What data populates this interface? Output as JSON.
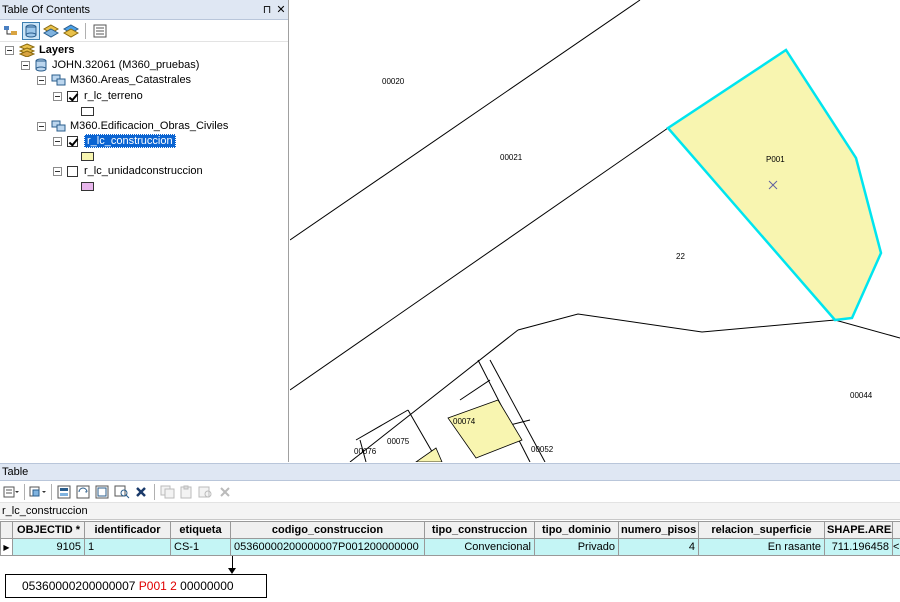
{
  "toc": {
    "title": "Table Of Contents",
    "pin_glyph": "⊓",
    "close_glyph": "✕",
    "layers_label": "Layers",
    "db_label": "JOHN.32061 (M360_pruebas)",
    "group1_label": "M360.Areas_Catastrales",
    "layer_terreno": "r_lc_terreno",
    "group2_label": "M360.Edificacion_Obras_Civiles",
    "layer_construccion": "r_lc_construccion",
    "layer_unidad": "r_lc_unidadconstruccion",
    "colors": {
      "terreno_fill": "#ffffff",
      "construccion_fill": "#f8f5b0",
      "unidad_fill": "#e8b6ec"
    }
  },
  "map": {
    "labels": {
      "l00020": "00020",
      "l00021": "00021",
      "lP001": "P001",
      "l22": "22",
      "l00044": "00044",
      "l00074": "00074",
      "l00075": "00075",
      "l00076": "00076",
      "l00052": "00052"
    },
    "colors": {
      "selection_outline": "#00e5ef",
      "polygon_fill": "#f8f5b0"
    }
  },
  "table": {
    "title": "Table",
    "layer_tab": "r_lc_construccion",
    "columns": [
      "OBJECTID *",
      "identificador",
      "etiqueta",
      "codigo_construccion",
      "tipo_construccion",
      "tipo_dominio",
      "numero_pisos",
      "relacion_superficie",
      "SHAPE.AREA"
    ],
    "row": {
      "objectid": "9105",
      "identificador": "1",
      "etiqueta": "CS-1",
      "codigo_construccion": "05360000200000007P001200000000",
      "tipo_construccion": "Convencional",
      "tipo_dominio": "Privado",
      "numero_pisos": "4",
      "relacion_superficie": "En rasante",
      "shape_area": "711.196458",
      "overflow": "<"
    },
    "selected_row_color": "#c4f5f5"
  },
  "annotation": {
    "part1": "05360000200000007 ",
    "part_red": "P001 2",
    "part3": " 00000000",
    "highlight_color": "#e00000"
  }
}
